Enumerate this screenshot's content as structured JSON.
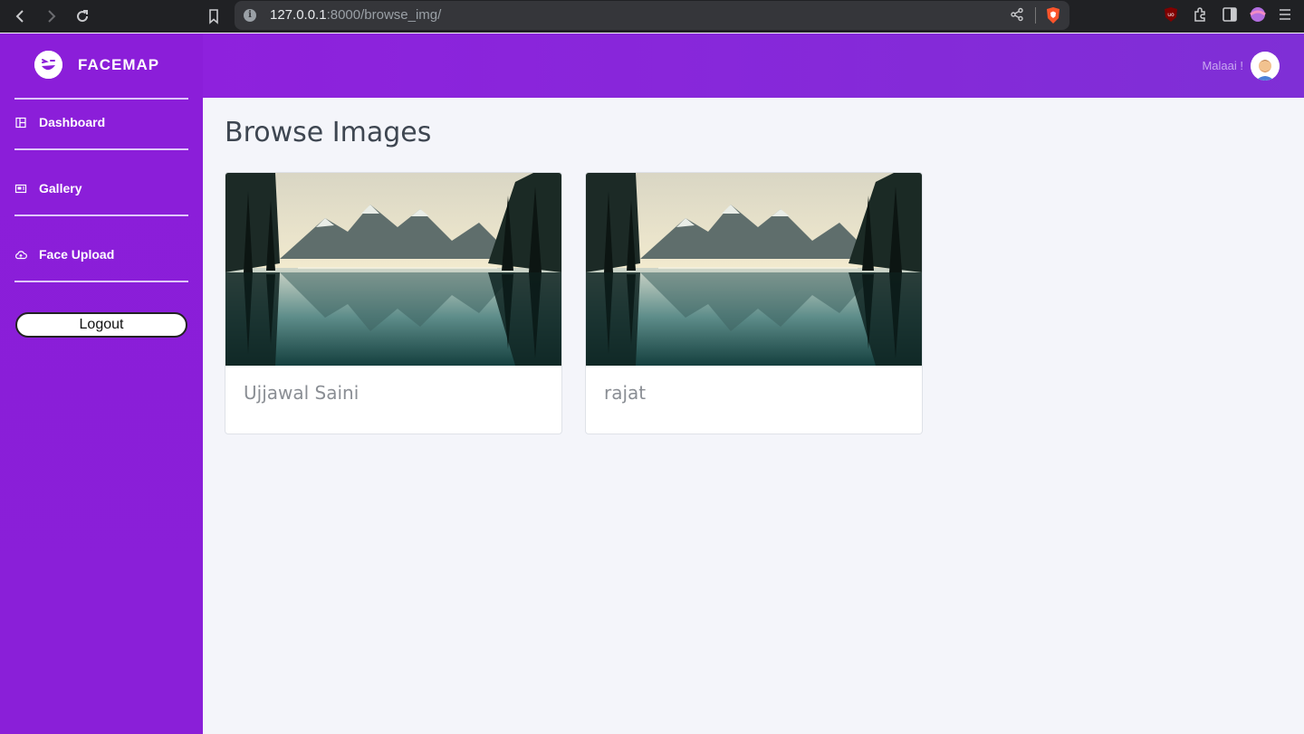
{
  "browser": {
    "url_host": "127.0.0.1",
    "url_path": ":8000/browse_img/"
  },
  "sidebar": {
    "brand": "FACEMAP",
    "items": [
      {
        "label": "Dashboard",
        "icon": "dashboard-icon"
      },
      {
        "label": "Gallery",
        "icon": "gallery-icon"
      },
      {
        "label": "Face Upload",
        "icon": "cloud-upload-icon"
      }
    ],
    "logout_label": "Logout"
  },
  "header": {
    "user_name": "Malaai !"
  },
  "main": {
    "title": "Browse Images",
    "cards": [
      {
        "name": "Ujjawal Saini"
      },
      {
        "name": "rajat"
      }
    ]
  },
  "colors": {
    "sidebar": "#8b1ed9",
    "header": "#8e21dd",
    "background": "#f4f5fa"
  }
}
